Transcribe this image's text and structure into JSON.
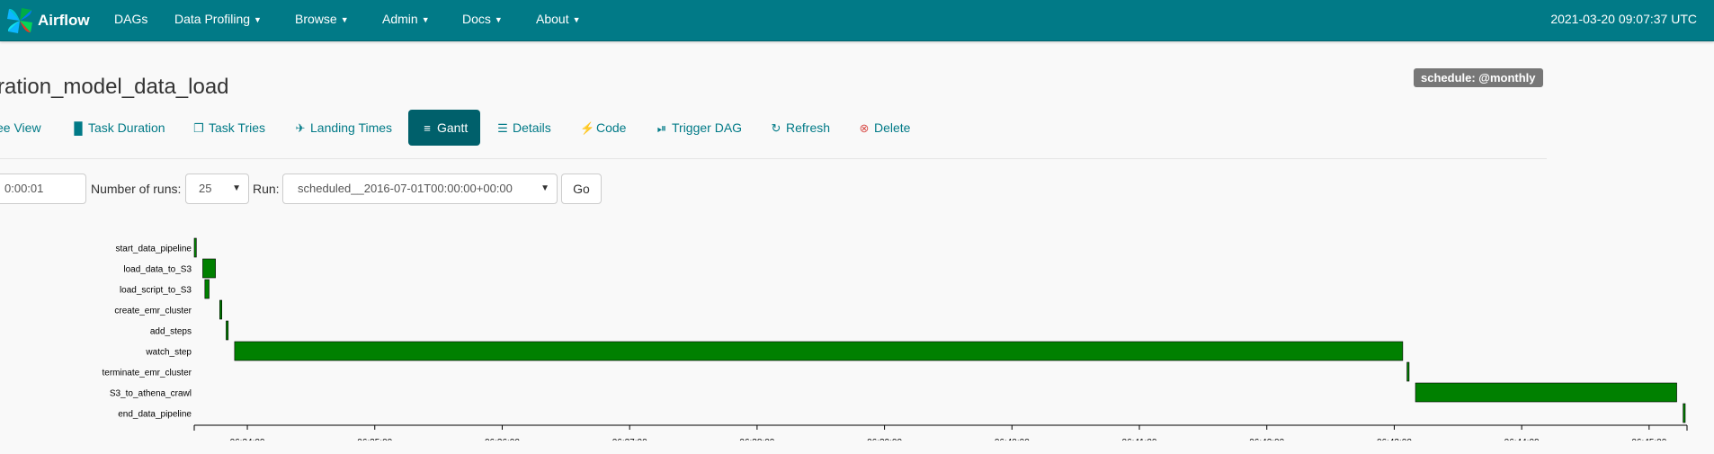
{
  "navbar": {
    "brand": "Airflow",
    "items": [
      {
        "label": "DAGs",
        "dropdown": false
      },
      {
        "label": "Data Profiling",
        "dropdown": true
      },
      {
        "label": "Browse",
        "dropdown": true
      },
      {
        "label": "Admin",
        "dropdown": true
      },
      {
        "label": "Docs",
        "dropdown": true
      },
      {
        "label": "About",
        "dropdown": true
      }
    ],
    "clock": "2021-03-20 09:07:37 UTC"
  },
  "dag": {
    "title": "ration_model_data_load",
    "schedule": "schedule: @monthly"
  },
  "tabs": [
    {
      "label": "ee View",
      "icon": "tree-icon"
    },
    {
      "label": "Task Duration",
      "icon": "bar-chart-icon"
    },
    {
      "label": "Task Tries",
      "icon": "files-icon"
    },
    {
      "label": "Landing Times",
      "icon": "plane-icon"
    },
    {
      "label": "Gantt",
      "icon": "align-left-icon",
      "active": true
    },
    {
      "label": "Details",
      "icon": "list-icon"
    },
    {
      "label": "Code",
      "icon": "flash-icon"
    },
    {
      "label": "Trigger DAG",
      "icon": "play-circle-icon"
    },
    {
      "label": "Refresh",
      "icon": "refresh-icon"
    },
    {
      "label": "Delete",
      "icon": "remove-circle-icon"
    }
  ],
  "form": {
    "base_date_value": "0:00:01",
    "num_runs_label": "Number of runs:",
    "num_runs_value": "25",
    "run_label": "Run:",
    "run_value": "scheduled__2016-07-01T00:00:00+00:00",
    "go_label": "Go"
  },
  "colors": {
    "navbar": "#017a87",
    "bar_success": "#008000",
    "active_tab": "#00606b",
    "link": "#017a87",
    "delete": "#d9534f"
  },
  "chart_data": {
    "type": "gantt",
    "tasks": [
      {
        "name": "start_data_pipeline",
        "start": "06:33:35",
        "end": "06:33:36"
      },
      {
        "name": "load_data_to_S3",
        "start": "06:33:39",
        "end": "06:33:45"
      },
      {
        "name": "load_script_to_S3",
        "start": "06:33:40",
        "end": "06:33:42"
      },
      {
        "name": "create_emr_cluster",
        "start": "06:33:47",
        "end": "06:33:48"
      },
      {
        "name": "add_steps",
        "start": "06:33:50",
        "end": "06:33:51"
      },
      {
        "name": "watch_step",
        "start": "06:33:54",
        "end": "06:43:04"
      },
      {
        "name": "terminate_emr_cluster",
        "start": "06:43:06",
        "end": "06:43:07"
      },
      {
        "name": "S3_to_athena_crawl",
        "start": "06:43:10",
        "end": "06:45:13"
      },
      {
        "name": "end_data_pipeline",
        "start": "06:45:16",
        "end": "06:45:17"
      }
    ],
    "x_ticks": [
      "06:34:00",
      "06:35:00",
      "06:36:00",
      "06:37:00",
      "06:38:00",
      "06:39:00",
      "06:40:00",
      "06:41:00",
      "06:42:00",
      "06:43:00",
      "06:44:00",
      "06:45:00"
    ],
    "x_range": [
      "06:33:35",
      "06:45:17"
    ],
    "state": "success"
  }
}
